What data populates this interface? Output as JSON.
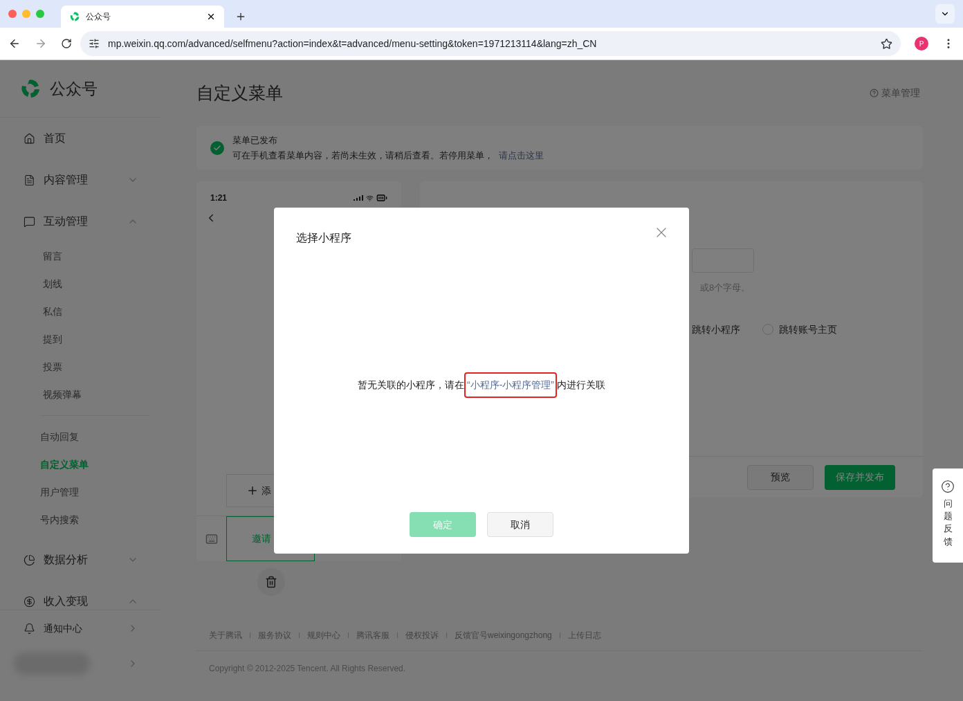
{
  "browser": {
    "tab_title": "公众号",
    "url": "mp.weixin.qq.com/advanced/selfmenu?action=index&t=advanced/menu-setting&token=1971213114&lang=zh_CN",
    "profile": "P"
  },
  "sidebar": {
    "logo": "公众号",
    "items": [
      {
        "label": "首页"
      },
      {
        "label": "内容管理",
        "expanded": false
      },
      {
        "label": "互动管理",
        "expanded": true,
        "child_groups": [
          [
            {
              "label": "留言",
              "selected": false
            },
            {
              "label": "划线",
              "selected": false
            },
            {
              "label": "私信",
              "selected": false
            },
            {
              "label": "提到",
              "selected": false
            },
            {
              "label": "投票",
              "selected": false
            },
            {
              "label": "视频弹幕",
              "selected": false
            }
          ],
          [
            {
              "label": "自动回复",
              "selected": false
            },
            {
              "label": "自定义菜单",
              "selected": true
            },
            {
              "label": "用户管理",
              "selected": false
            },
            {
              "label": "号内搜索",
              "selected": false
            }
          ]
        ]
      },
      {
        "label": "数据分析",
        "expanded": false
      },
      {
        "label": "收入变现",
        "expanded": true
      }
    ],
    "bottom": {
      "label": "通知中心"
    }
  },
  "main": {
    "title": "自定义菜单",
    "help_link": "菜单管理",
    "notice": {
      "title": "菜单已发布",
      "text": "可在手机查看菜单内容，若尚未生效，请稍后查看。若停用菜单，",
      "link": "请点击这里"
    },
    "phone": {
      "time": "1:21",
      "add_label": "添",
      "menu_label": "邀请"
    },
    "editor": {
      "hint": "或8个字母。",
      "options": [
        {
          "label": "跳转小程序"
        },
        {
          "label": "跳转账号主页",
          "selected": false
        }
      ],
      "preview": "预览",
      "publish": "保存并发布"
    },
    "footer_links": [
      "关于腾讯",
      "服务协议",
      "规则中心",
      "腾讯客服",
      "侵权投诉",
      "反馈官号weixingongzhong",
      "上传日志"
    ],
    "copyright": "Copyright © 2012-2025 Tencent. All Rights Reserved."
  },
  "feedback": "问题反馈",
  "dialog": {
    "title": "选择小程序",
    "message_before": "暂无关联的小程序，请在",
    "link": "“小程序-小程序管理”",
    "link_highlighted": true,
    "message_after": "内进行关联",
    "confirm": {
      "label": "确定",
      "disabled": true
    },
    "cancel": "取消"
  }
}
